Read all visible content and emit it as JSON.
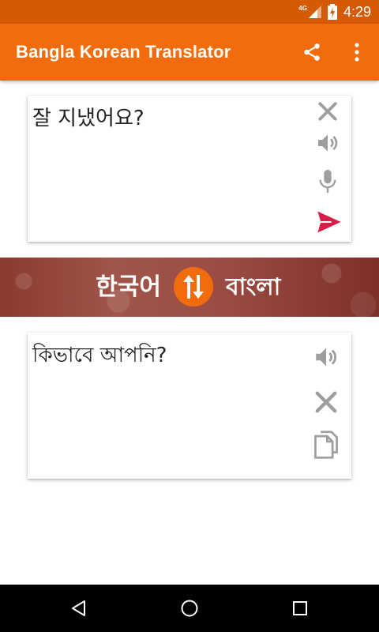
{
  "status_bar": {
    "time": "4:29",
    "network": "4G"
  },
  "app_bar": {
    "title": "Bangla Korean Translator",
    "icons": [
      "share-icon",
      "overflow-menu-icon"
    ],
    "color": "#f26b0d"
  },
  "input_card": {
    "text": "잘 지냈어요?",
    "icons": [
      "close-icon",
      "speaker-icon",
      "microphone-icon",
      "send-icon"
    ],
    "send_color": "#d81b47"
  },
  "language_bar": {
    "source_language": "한국어",
    "target_language": "বাংলা",
    "swap_icon": "swap-vertical-icon"
  },
  "output_card": {
    "text": "কিভাবে আপনি?",
    "icons": [
      "speaker-icon",
      "close-icon",
      "copy-icon"
    ]
  },
  "nav_bar": {
    "icons": [
      "back-icon",
      "home-icon",
      "recents-icon"
    ]
  }
}
